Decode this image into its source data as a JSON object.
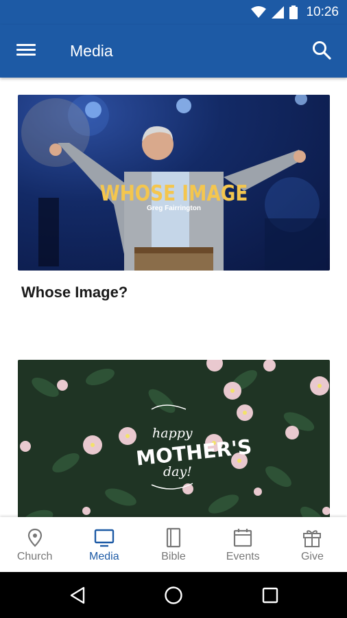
{
  "status_bar": {
    "time": "10:26"
  },
  "app_bar": {
    "title": "Media"
  },
  "media": [
    {
      "title": "Whose Image?",
      "thumbnail_title": "WHOSE IMAGE",
      "thumbnail_speaker": "Greg Fairrington"
    },
    {
      "thumbnail_text": [
        "happy",
        "MOTHER'S",
        "day!"
      ]
    }
  ],
  "bottom_nav": {
    "active": "Media",
    "items": [
      {
        "label": "Church",
        "icon": "location-pin-icon"
      },
      {
        "label": "Media",
        "icon": "tv-icon"
      },
      {
        "label": "Bible",
        "icon": "book-icon"
      },
      {
        "label": "Events",
        "icon": "calendar-icon"
      },
      {
        "label": "Give",
        "icon": "gift-icon"
      }
    ]
  },
  "colors": {
    "primary": "#1d5aa5",
    "inactive": "#777777",
    "thumbnail_title": "#f4c64e"
  }
}
